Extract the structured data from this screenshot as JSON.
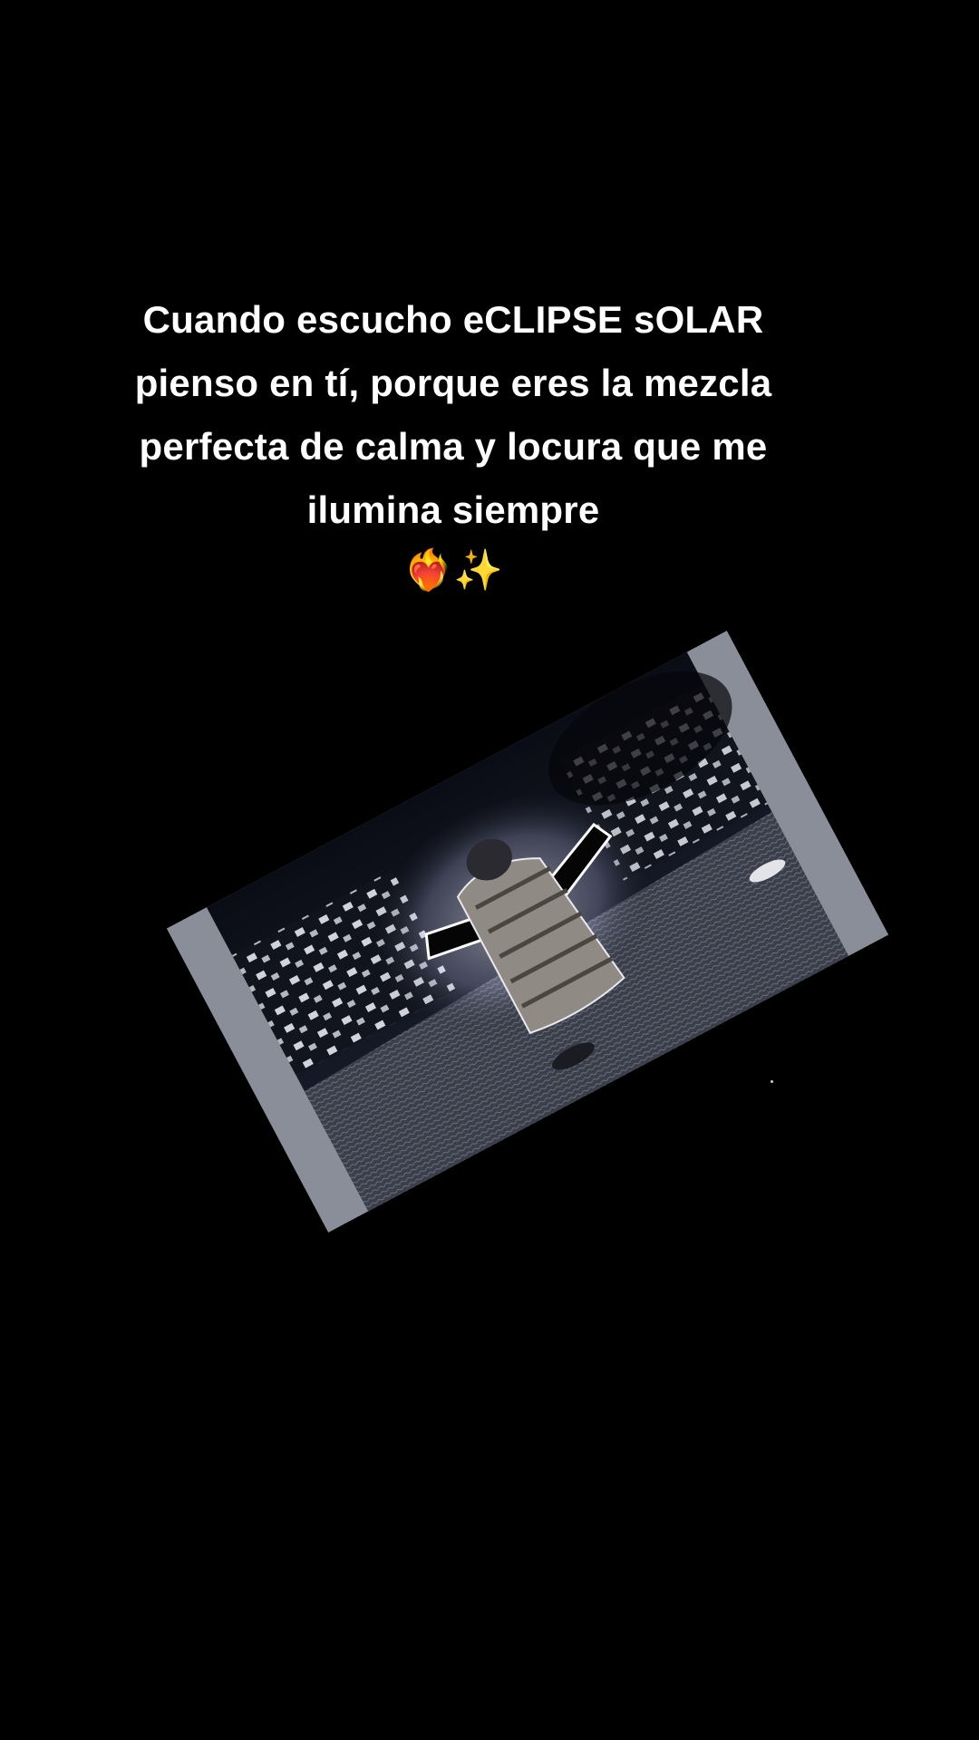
{
  "caption": {
    "lines": [
      "Cuando escucho eCLIPSE sOLAR",
      "pienso en tí, porque eres la mezcla",
      "perfecta de calma y locura que me",
      "ilumina siempre"
    ],
    "emoji": "❤️‍🔥✨"
  },
  "colors": {
    "background": "#000000",
    "caption_text": "#ffffff"
  }
}
